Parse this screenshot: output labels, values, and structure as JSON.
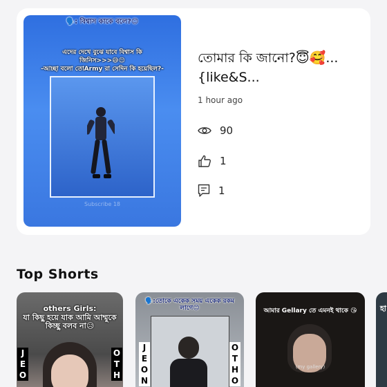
{
  "video": {
    "thumbnail": {
      "header": "🗣️: বিশ্বাস কাকে বলে?😊",
      "line1": "এদের দেখে বুঝে যাবে বিশ্বাস কি",
      "line2": "জিনিস>>>😅😌",
      "line3": "-আচ্ছা বলো তোArmy রা সেদিন কি হয়েছিল?-",
      "watermark": "Subscribe 18"
    },
    "title": "তোমার কি জানো?😇🥰...{like&S...",
    "time_ago": "1 hour ago",
    "views": "90",
    "likes": "1",
    "comments": "1"
  },
  "section": {
    "title": "Top Shorts"
  },
  "shorts": [
    {
      "caption": "others Girls:\nযা কিছু হয়ে যাক আমি আম্মুকে কিচ্ছু বলব না😥",
      "vert_left": "J\nE\nO",
      "vert_right": "O\nT\nH"
    },
    {
      "caption": "🗣️:তোকে একেক সময় একেক রকম লাগে😊",
      "vert_left": "J\nE\nO\nN",
      "vert_right": "O\nT\nH\nO"
    },
    {
      "caption": "আমার Gellary তে এমনই থাকে 😘",
      "inner": "(my gallery)"
    },
    {
      "caption": "হা"
    }
  ],
  "colors": {
    "background": "#f4f4f6",
    "card": "#ffffff",
    "thumb_blue": "#3a77e0"
  }
}
